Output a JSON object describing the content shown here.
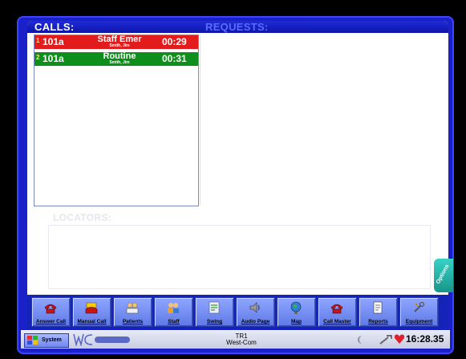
{
  "calls": {
    "title": "CALLS:",
    "rows": [
      {
        "num": "1",
        "room": "101a",
        "type": "Staff Emer",
        "staff": "Smith, Jim",
        "time": "00:29",
        "color": "#e21c1c"
      },
      {
        "num": "2",
        "room": "101a",
        "type": "Routine",
        "staff": "Smith, Jim",
        "time": "00:31",
        "color": "#0e8f1c"
      }
    ]
  },
  "requests": {
    "title": "REQUESTS:"
  },
  "locators": {
    "title": "LOCATORS:"
  },
  "options_tab": {
    "label": "Options"
  },
  "toolbar": {
    "buttons": [
      {
        "label": "Answer Call",
        "icon": "phone-red-icon"
      },
      {
        "label": "Manual Call",
        "icon": "phone-yellow-icon"
      },
      {
        "label": "Patients",
        "icon": "patients-icon"
      },
      {
        "label": "Staff",
        "icon": "staff-icon"
      },
      {
        "label": "Swing",
        "icon": "swing-icon"
      },
      {
        "label": "Audio Page",
        "icon": "speaker-icon"
      },
      {
        "label": "Map",
        "icon": "globe-icon"
      },
      {
        "label": "Call Master",
        "icon": "phone-icon"
      },
      {
        "label": "Reports",
        "icon": "report-icon"
      },
      {
        "label": "Equipment",
        "icon": "equipment-icon"
      }
    ]
  },
  "statusbar": {
    "system_label": "System",
    "station_name": "TR1",
    "station_site": "West-Com",
    "time": "16:28.35"
  },
  "colors": {
    "frame": "#1b21c8",
    "toolbar": "#1424b8",
    "header_title": "#ffffff",
    "faded_title": "#5b6cff"
  }
}
